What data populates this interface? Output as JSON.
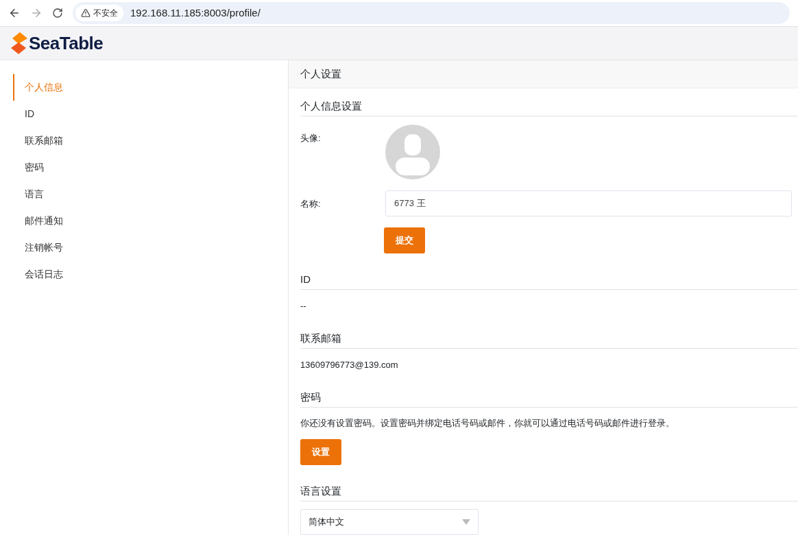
{
  "browser": {
    "security_label": "不安全",
    "url": "192.168.11.185:8003/profile/"
  },
  "header": {
    "logo_text": "SeaTable"
  },
  "sidebar": {
    "items": [
      {
        "label": "个人信息",
        "selected": true
      },
      {
        "label": "ID",
        "selected": false
      },
      {
        "label": "联系邮箱",
        "selected": false
      },
      {
        "label": "密码",
        "selected": false
      },
      {
        "label": "语言",
        "selected": false
      },
      {
        "label": "邮件通知",
        "selected": false
      },
      {
        "label": "注销帐号",
        "selected": false
      },
      {
        "label": "会话日志",
        "selected": false
      }
    ]
  },
  "main": {
    "title": "个人设置",
    "profile": {
      "heading": "个人信息设置",
      "avatar_label": "头像:",
      "name_label": "名称:",
      "name_value": "6773 王",
      "submit_button": "提交"
    },
    "id": {
      "heading": "ID",
      "value": "--"
    },
    "email": {
      "heading": "联系邮箱",
      "value": "13609796773@139.com"
    },
    "password": {
      "heading": "密码",
      "description": "你还没有设置密码。设置密码并绑定电话号码或邮件，你就可以通过电话号码或邮件进行登录。",
      "button": "设置"
    },
    "language": {
      "heading": "语言设置",
      "value": "简体中文"
    }
  }
}
